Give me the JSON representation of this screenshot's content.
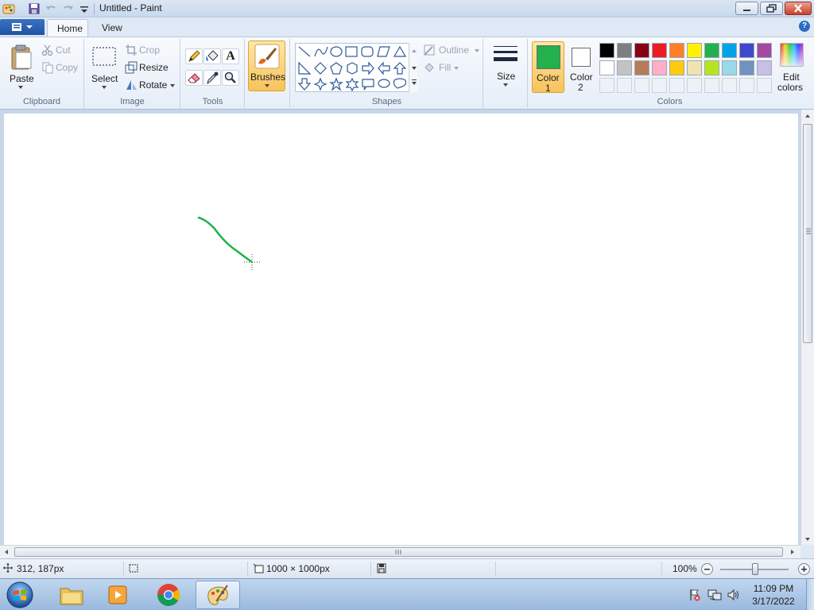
{
  "window": {
    "title": "Untitled - Paint"
  },
  "tabs": {
    "home": "Home",
    "view": "View"
  },
  "clipboard": {
    "paste": "Paste",
    "cut": "Cut",
    "copy": "Copy",
    "label": "Clipboard"
  },
  "image": {
    "select": "Select",
    "crop": "Crop",
    "resize": "Resize",
    "rotate": "Rotate",
    "label": "Image"
  },
  "tools": {
    "label": "Tools",
    "text_glyph": "A"
  },
  "brushes": {
    "label": "Brushes"
  },
  "shapes": {
    "outline": "Outline",
    "fill": "Fill",
    "label": "Shapes"
  },
  "size": {
    "label": "Size"
  },
  "colors": {
    "color1_line1": "Color",
    "color1_line2": "1",
    "color2_line1": "Color",
    "color2_line2": "2",
    "color1_value": "#22b14c",
    "color2_value": "#ffffff",
    "edit_line1": "Edit",
    "edit_line2": "colors",
    "label": "Colors",
    "palette_row1": [
      "#000000",
      "#7f7f7f",
      "#880015",
      "#ed1c24",
      "#ff7f27",
      "#fff200",
      "#22b14c",
      "#00a2e8",
      "#3f48cc",
      "#a349a4"
    ],
    "palette_row2": [
      "#ffffff",
      "#c3c3c3",
      "#b97a57",
      "#ffaec9",
      "#ffc90e",
      "#efe4b0",
      "#b5e61d",
      "#99d9ea",
      "#7092be",
      "#c8bfe7"
    ]
  },
  "status": {
    "cursor_pos": "312, 187px",
    "canvas_size": "1000 × 1000px",
    "zoom": "100%"
  },
  "taskbar": {
    "time": "11:09 PM",
    "date": "3/17/2022"
  }
}
